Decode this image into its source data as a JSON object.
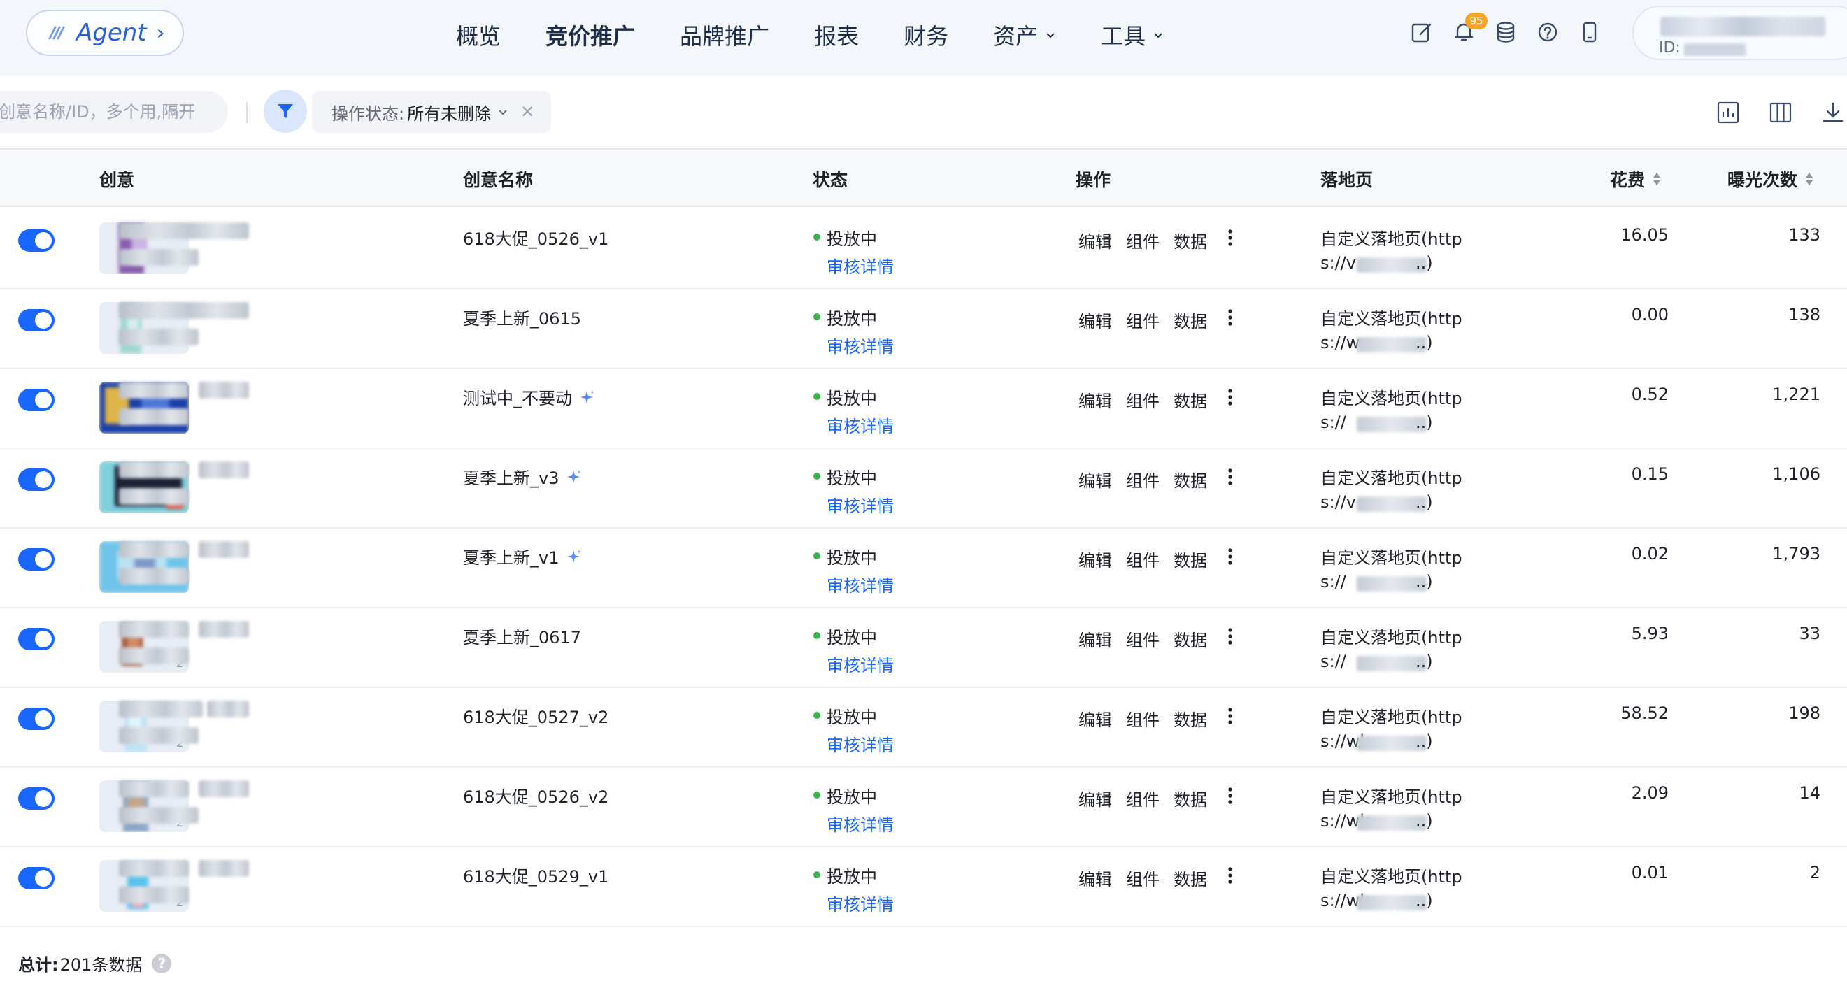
{
  "topbar": {
    "agent_label": "Agent",
    "nav": [
      {
        "label": "概览",
        "active": false,
        "dropdown": false
      },
      {
        "label": "竞价推广",
        "active": true,
        "dropdown": false
      },
      {
        "label": "品牌推广",
        "active": false,
        "dropdown": false
      },
      {
        "label": "报表",
        "active": false,
        "dropdown": false
      },
      {
        "label": "财务",
        "active": false,
        "dropdown": false
      },
      {
        "label": "资产",
        "active": false,
        "dropdown": true
      },
      {
        "label": "工具",
        "active": false,
        "dropdown": true
      }
    ],
    "icons": [
      "edit-icon",
      "bell-icon",
      "database-icon",
      "help-icon",
      "mobile-icon"
    ],
    "notification_count": "95",
    "account_id_label": "ID:"
  },
  "filters": {
    "search_placeholder": "创意名称/ID，多个用,隔开",
    "status_key": "操作状态:",
    "status_value": "所有未删除"
  },
  "table": {
    "headers": {
      "creative": "创意",
      "name": "创意名称",
      "status": "状态",
      "ops": "操作",
      "landing": "落地页",
      "cost": "花费",
      "impressions": "曝光次数"
    },
    "op_labels": {
      "edit": "编辑",
      "component": "组件",
      "data": "数据"
    },
    "status_text": "投放中",
    "review_link": "审核详情",
    "landing_line1": "自定义落地页(http",
    "rows": [
      {
        "enabled": true,
        "name": "618大促_0526_v1",
        "ai": false,
        "lp_prefix": "s://v",
        "cost": "16.05",
        "impressions": "133",
        "thumb": "purple",
        "count": ""
      },
      {
        "enabled": true,
        "name": "夏季上新_0615",
        "ai": false,
        "lp_prefix": "s://w",
        "cost": "0.00",
        "impressions": "138",
        "thumb": "teal",
        "count": ""
      },
      {
        "enabled": true,
        "name": "测试中_不要动",
        "ai": true,
        "lp_prefix": "s://",
        "cost": "0.52",
        "impressions": "1,221",
        "thumb": "navy",
        "count": ""
      },
      {
        "enabled": true,
        "name": "夏季上新_v3",
        "ai": true,
        "lp_prefix": "s://v",
        "cost": "0.15",
        "impressions": "1,106",
        "thumb": "dark",
        "count": ""
      },
      {
        "enabled": true,
        "name": "夏季上新_v1",
        "ai": true,
        "lp_prefix": "s://",
        "cost": "0.02",
        "impressions": "1,793",
        "thumb": "sky",
        "count": ""
      },
      {
        "enabled": true,
        "name": "夏季上新_0617",
        "ai": false,
        "lp_prefix": "s://",
        "cost": "5.93",
        "impressions": "33",
        "thumb": "brown",
        "count": "2"
      },
      {
        "enabled": true,
        "name": "618大促_0527_v2",
        "ai": false,
        "lp_prefix": "s://wk.",
        "cost": "58.52",
        "impressions": "198",
        "thumb": "lightblue",
        "count": "2"
      },
      {
        "enabled": true,
        "name": "618大促_0526_v2",
        "ai": false,
        "lp_prefix": "s://wk.",
        "cost": "2.09",
        "impressions": "14",
        "thumb": "bluegrey",
        "count": "2"
      },
      {
        "enabled": true,
        "name": "618大促_0529_v1",
        "ai": false,
        "lp_prefix": "s://wk",
        "cost": "0.01",
        "impressions": "2",
        "thumb": "cyan",
        "count": "2"
      }
    ]
  },
  "footer": {
    "total_label": "总计:",
    "total_value": "201条数据"
  },
  "colors": {
    "primary": "#1966ff",
    "status_green": "#3ab54a",
    "badge": "#f5a623"
  }
}
